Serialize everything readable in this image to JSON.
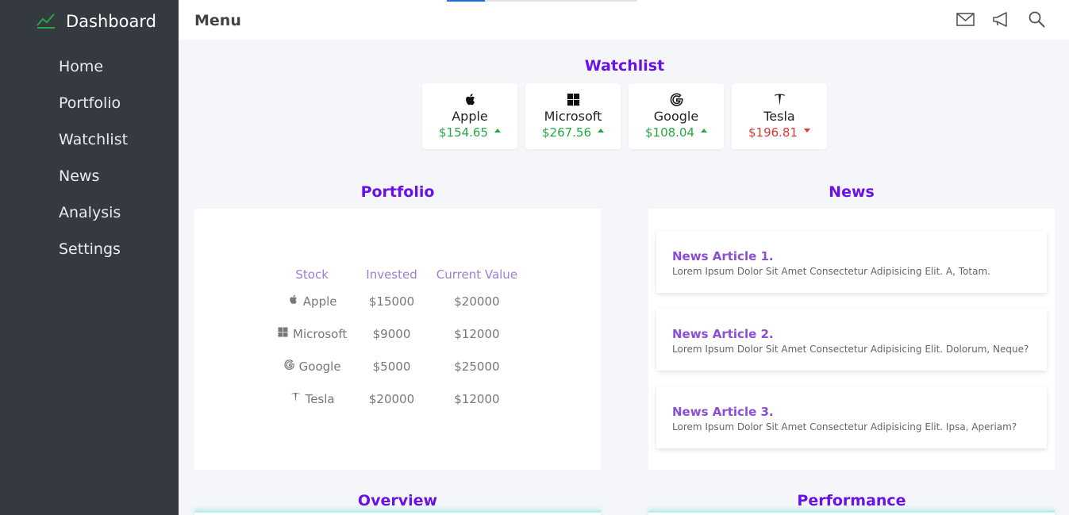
{
  "sidebar": {
    "brand": "Dashboard",
    "items": [
      {
        "label": "Home"
      },
      {
        "label": "Portfolio"
      },
      {
        "label": "Watchlist"
      },
      {
        "label": "News"
      },
      {
        "label": "Analysis"
      },
      {
        "label": "Settings"
      }
    ]
  },
  "topbar": {
    "title": "Menu",
    "icons": [
      "mail-icon",
      "megaphone-icon",
      "search-icon"
    ]
  },
  "watchlist": {
    "title": "Watchlist",
    "cards": [
      {
        "name": "Apple",
        "price": "$154.65",
        "trend": "up",
        "icon": "apple-icon"
      },
      {
        "name": "Microsoft",
        "price": "$267.56",
        "trend": "up",
        "icon": "microsoft-icon"
      },
      {
        "name": "Google",
        "price": "$108.04",
        "trend": "up",
        "icon": "google-icon"
      },
      {
        "name": "Tesla",
        "price": "$196.81",
        "trend": "down",
        "icon": "tesla-icon"
      }
    ]
  },
  "portfolio": {
    "title": "Portfolio",
    "columns": [
      "Stock",
      "Invested",
      "Current Value"
    ],
    "rows": [
      {
        "stock": "Apple",
        "invested": "$15000",
        "current": "$20000"
      },
      {
        "stock": "Microsoft",
        "invested": "$9000",
        "current": "$12000"
      },
      {
        "stock": "Google",
        "invested": "$5000",
        "current": "$25000"
      },
      {
        "stock": "Tesla",
        "invested": "$20000",
        "current": "$12000"
      }
    ]
  },
  "news": {
    "title": "News",
    "articles": [
      {
        "title": "News Article 1.",
        "body": "Lorem Ipsum Dolor Sit Amet Consectetur Adipisicing Elit. A, Totam."
      },
      {
        "title": "News Article 2.",
        "body": "Lorem Ipsum Dolor Sit Amet Consectetur Adipisicing Elit. Dolorum, Neque?"
      },
      {
        "title": "News Article 3.",
        "body": "Lorem Ipsum Dolor Sit Amet Consectetur Adipisicing Elit. Ipsa, Aperiam?"
      }
    ]
  },
  "overview": {
    "title": "Overview"
  },
  "performance": {
    "title": "Performance"
  },
  "colors": {
    "sidebar_bg": "#343a40",
    "accent": "#6a11e6",
    "up": "#28a745",
    "down": "#d73a3a",
    "brand_icon": "#28a745"
  }
}
